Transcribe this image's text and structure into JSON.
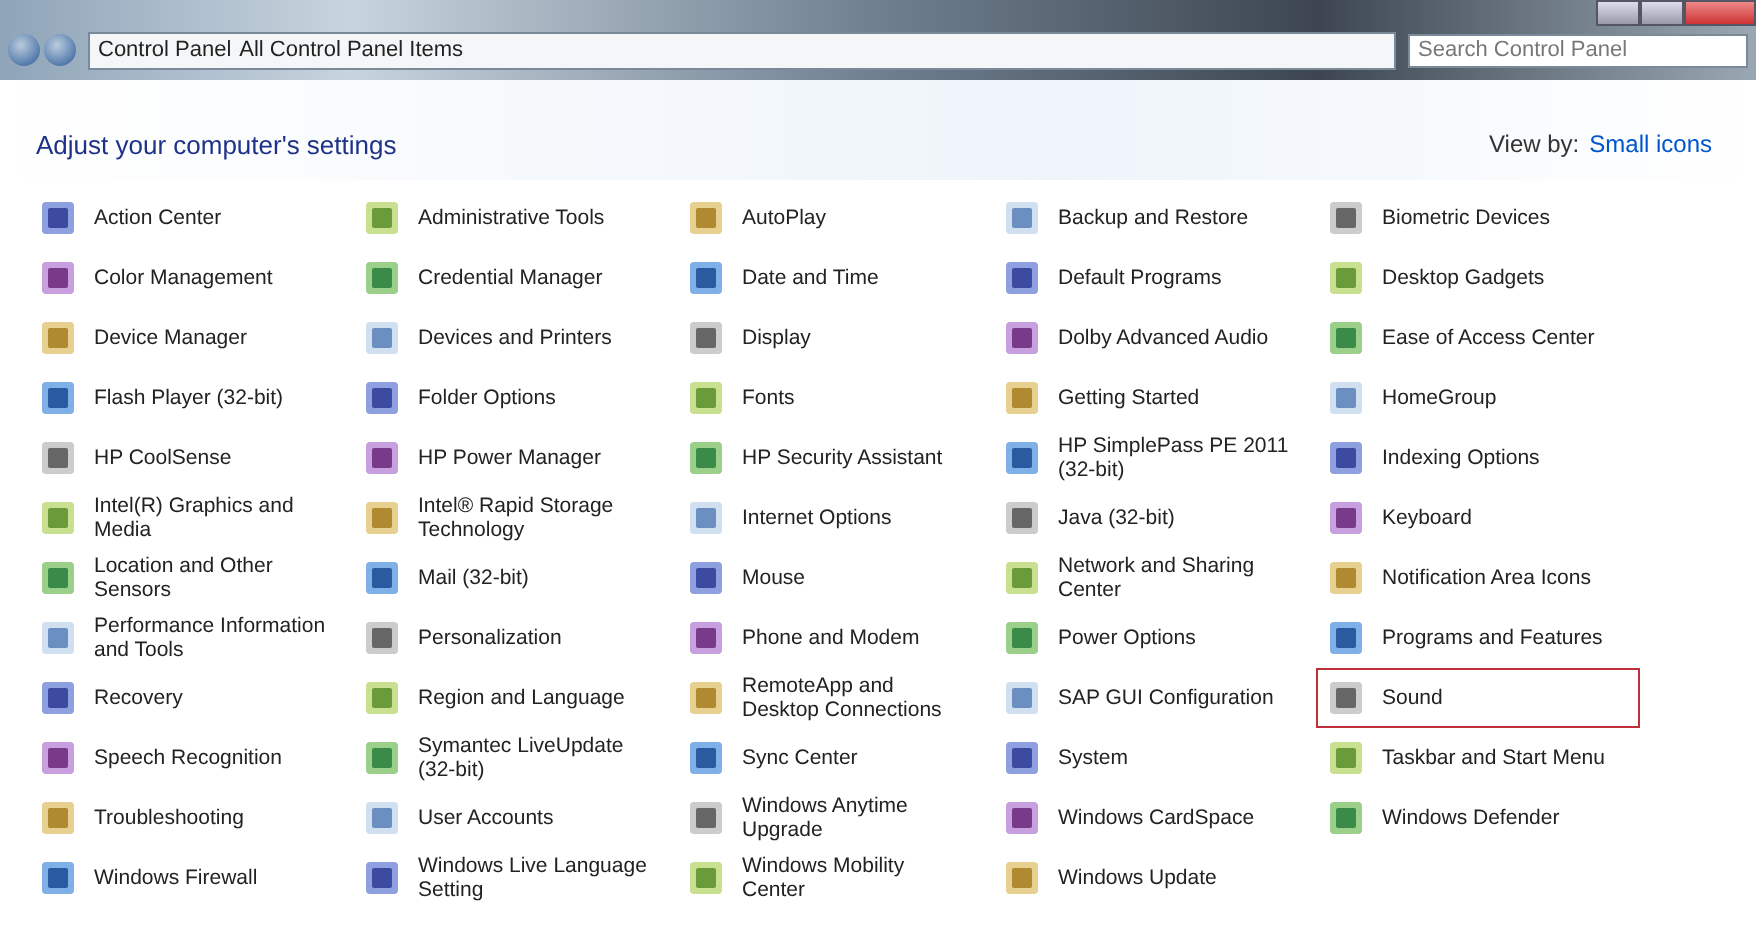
{
  "address_bar": {
    "breadcrumb": [
      "Control Panel",
      "All Control Panel Items"
    ],
    "search": {
      "placeholder": "Search Control Panel"
    }
  },
  "header": {
    "title": "Adjust your computer's settings",
    "view_by_label": "View by:",
    "view_by_value": "Small icons"
  },
  "items": [
    {
      "label": "Action Center",
      "highlighted": false
    },
    {
      "label": "Administrative Tools",
      "highlighted": false
    },
    {
      "label": "AutoPlay",
      "highlighted": false
    },
    {
      "label": "Backup and Restore",
      "highlighted": false
    },
    {
      "label": "Biometric Devices",
      "highlighted": false
    },
    {
      "label": "Color Management",
      "highlighted": false
    },
    {
      "label": "Credential Manager",
      "highlighted": false
    },
    {
      "label": "Date and Time",
      "highlighted": false
    },
    {
      "label": "Default Programs",
      "highlighted": false
    },
    {
      "label": "Desktop Gadgets",
      "highlighted": false
    },
    {
      "label": "Device Manager",
      "highlighted": false
    },
    {
      "label": "Devices and Printers",
      "highlighted": false
    },
    {
      "label": "Display",
      "highlighted": false
    },
    {
      "label": "Dolby Advanced Audio",
      "highlighted": false
    },
    {
      "label": "Ease of Access Center",
      "highlighted": false
    },
    {
      "label": "Flash Player (32-bit)",
      "highlighted": false
    },
    {
      "label": "Folder Options",
      "highlighted": false
    },
    {
      "label": "Fonts",
      "highlighted": false
    },
    {
      "label": "Getting Started",
      "highlighted": false
    },
    {
      "label": "HomeGroup",
      "highlighted": false
    },
    {
      "label": "HP CoolSense",
      "highlighted": false
    },
    {
      "label": "HP Power Manager",
      "highlighted": false
    },
    {
      "label": "HP Security Assistant",
      "highlighted": false
    },
    {
      "label": "HP SimplePass PE 2011 (32-bit)",
      "highlighted": false
    },
    {
      "label": "Indexing Options",
      "highlighted": false
    },
    {
      "label": "Intel(R) Graphics and Media",
      "highlighted": false
    },
    {
      "label": "Intel® Rapid Storage Technology",
      "highlighted": false
    },
    {
      "label": "Internet Options",
      "highlighted": false
    },
    {
      "label": "Java (32-bit)",
      "highlighted": false
    },
    {
      "label": "Keyboard",
      "highlighted": false
    },
    {
      "label": "Location and Other Sensors",
      "highlighted": false
    },
    {
      "label": "Mail (32-bit)",
      "highlighted": false
    },
    {
      "label": "Mouse",
      "highlighted": false
    },
    {
      "label": "Network and Sharing Center",
      "highlighted": false
    },
    {
      "label": "Notification Area Icons",
      "highlighted": false
    },
    {
      "label": "Performance Information and Tools",
      "highlighted": false
    },
    {
      "label": "Personalization",
      "highlighted": false
    },
    {
      "label": "Phone and Modem",
      "highlighted": false
    },
    {
      "label": "Power Options",
      "highlighted": false
    },
    {
      "label": "Programs and Features",
      "highlighted": false
    },
    {
      "label": "Recovery",
      "highlighted": false
    },
    {
      "label": "Region and Language",
      "highlighted": false
    },
    {
      "label": "RemoteApp and Desktop Connections",
      "highlighted": false
    },
    {
      "label": "SAP GUI Configuration",
      "highlighted": false
    },
    {
      "label": "Sound",
      "highlighted": true
    },
    {
      "label": "Speech Recognition",
      "highlighted": false
    },
    {
      "label": "Symantec LiveUpdate (32-bit)",
      "highlighted": false
    },
    {
      "label": "Sync Center",
      "highlighted": false
    },
    {
      "label": "System",
      "highlighted": false
    },
    {
      "label": "Taskbar and Start Menu",
      "highlighted": false
    },
    {
      "label": "Troubleshooting",
      "highlighted": false
    },
    {
      "label": "User Accounts",
      "highlighted": false
    },
    {
      "label": "Windows Anytime Upgrade",
      "highlighted": false
    },
    {
      "label": "Windows CardSpace",
      "highlighted": false
    },
    {
      "label": "Windows Defender",
      "highlighted": false
    },
    {
      "label": "Windows Firewall",
      "highlighted": false
    },
    {
      "label": "Windows Live Language Setting",
      "highlighted": false
    },
    {
      "label": "Windows Mobility Center",
      "highlighted": false
    },
    {
      "label": "Windows Update",
      "highlighted": false
    }
  ]
}
